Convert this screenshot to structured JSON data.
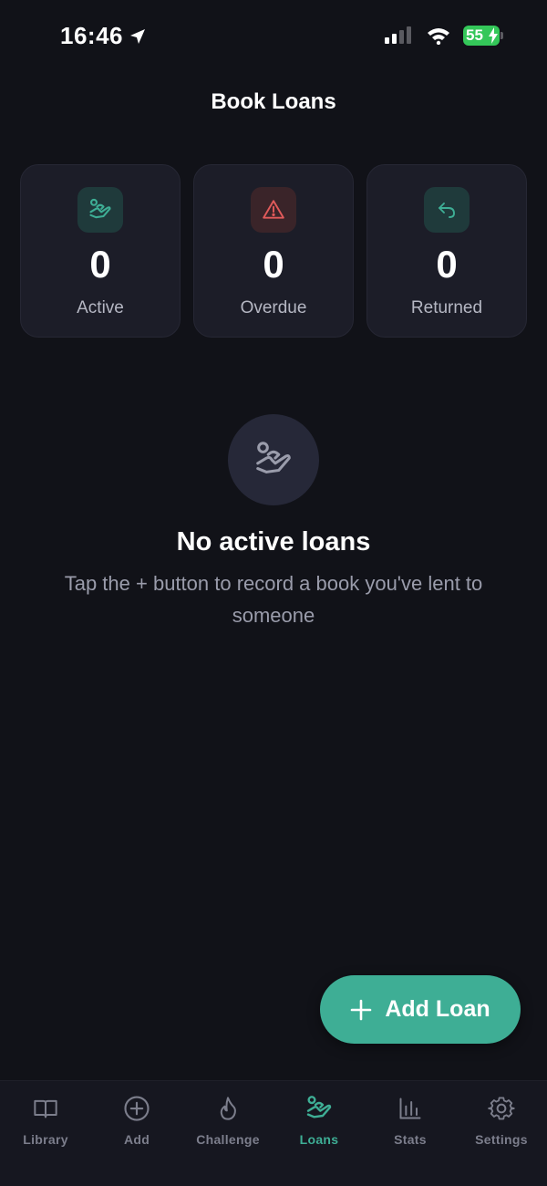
{
  "status_bar": {
    "time": "16:46",
    "battery": "55"
  },
  "header": {
    "title": "Book Loans"
  },
  "stats": [
    {
      "value": "0",
      "label": "Active",
      "icon": "hand-heart-icon",
      "color": "#3eae95"
    },
    {
      "value": "0",
      "label": "Overdue",
      "icon": "warning-triangle-icon",
      "color": "#e05a5a"
    },
    {
      "value": "0",
      "label": "Returned",
      "icon": "return-arrow-icon",
      "color": "#3eae95"
    }
  ],
  "empty_state": {
    "title": "No active loans",
    "description": "Tap the + button to record a book you've lent to someone"
  },
  "fab": {
    "label": "Add Loan"
  },
  "tabs": [
    {
      "label": "Library",
      "icon": "book-open-icon",
      "active": false
    },
    {
      "label": "Add",
      "icon": "plus-circle-icon",
      "active": false
    },
    {
      "label": "Challenge",
      "icon": "flame-icon",
      "active": false
    },
    {
      "label": "Loans",
      "icon": "hand-heart-icon",
      "active": true
    },
    {
      "label": "Stats",
      "icon": "bar-chart-icon",
      "active": false
    },
    {
      "label": "Settings",
      "icon": "gear-icon",
      "active": false
    }
  ],
  "colors": {
    "accent": "#3eae95",
    "danger": "#e05a5a",
    "background": "#111218"
  }
}
